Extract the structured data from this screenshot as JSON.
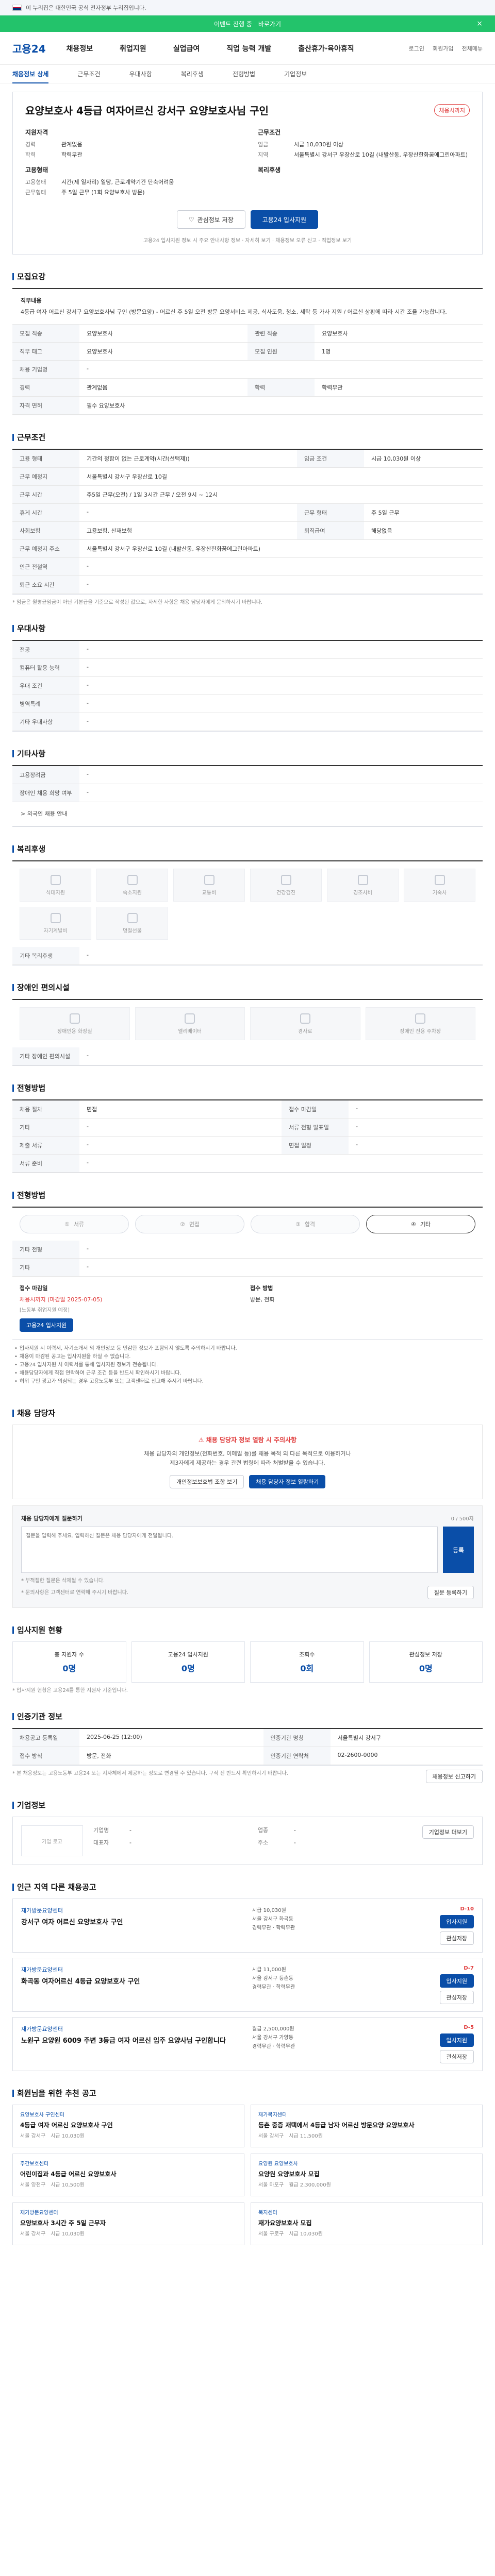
{
  "gov_bar": "이 누리집은 대한민국 공식 전자정부 누리집입니다.",
  "event_banner": {
    "text": "이벤트 진행 중",
    "cta": "바로가기",
    "close": "×"
  },
  "header": {
    "logo": "고용24",
    "gnb": [
      "채용정보",
      "취업지원",
      "실업급여",
      "직업 능력 개발",
      "출산휴가·육아휴직"
    ],
    "util": [
      "로그인",
      "회원가입",
      "전체메뉴"
    ]
  },
  "subnav": [
    "채용정보 상세",
    "근무조건",
    "우대사항",
    "복리후생",
    "전형방법",
    "기업정보"
  ],
  "job": {
    "title": "요양보호사 4등급 여자어르신 강서구 요양보호사님 구인",
    "badge": "채용시까지",
    "summary_left_title": "지원자격",
    "summary_left": [
      {
        "k": "경력",
        "v": "관계없음"
      },
      {
        "k": "학력",
        "v": "학력무관"
      }
    ],
    "summary_right_title": "근무조건",
    "summary_right": [
      {
        "k": "임금",
        "v": "시급 10,030원 이상"
      },
      {
        "k": "지역",
        "v": "서울특별시 강서구 우장산로 10길 (내발산동, 우장산한화꿈에그린아파트)"
      }
    ],
    "summary_left2_title": "고용형태",
    "summary_left2": [
      {
        "k": "고용형태",
        "v": "시간(제 일자리) 일당, 근로계약기간 단축어려움"
      },
      {
        "k": "근무형태",
        "v": "주 5일 근무 (1회 요양보호사 방문)"
      }
    ],
    "summary_right2_title": "복리후생",
    "summary_right2": [
      {
        "k": "",
        "v": ""
      }
    ],
    "btn_scrap": "관심정보 저장",
    "btn_apply": "고용24 입사지원",
    "notice": "고용24 입사지원 정보 시 주요 안내사항 정보 · 자세히 보기 · 채용정보 오류 신고 · 직업정보 보기"
  },
  "recruit": {
    "heading": "모집요강",
    "desc_label": "직무내용",
    "desc": "4등급 여자 어르신 강서구 요양보호사님 구인 (방문요양) - 어르신 주 5일 오전 방문 요양서비스 제공, 식사도움, 청소, 세탁 등 가사 지원 / 어르신 상황에 따라 시간 조율 가능합니다.",
    "rows": [
      {
        "k": "모집 직종",
        "v": "요양보호사",
        "k2": "관련 직종",
        "v2": "요양보호사"
      },
      {
        "k": "직무 태그",
        "v": "요양보호사",
        "k2": "모집 인원",
        "v2": "1명"
      },
      {
        "k": "채용 기업명",
        "v": "-",
        "k2": "",
        "v2": ""
      },
      {
        "k": "경력",
        "v": "관계없음",
        "k2": "학력",
        "v2": "학력무관"
      },
      {
        "k": "자격 면허",
        "v": "필수 요양보호사",
        "k2": "",
        "v2": ""
      }
    ]
  },
  "conditions": {
    "heading": "근무조건",
    "rows": [
      {
        "k": "고용 형태",
        "v": "기간의 정함이 없는 근로계약(시간(선택제))",
        "k2": "임금 조건",
        "v2": "시급 10,030원 이상"
      },
      {
        "k": "근무 예정지",
        "v": "서울특별시 강서구 우장산로 10길",
        "k2": "",
        "v2": ""
      },
      {
        "k": "근무 시간",
        "v": "주5일 근무(오전) / 1일 3시간 근무 / 오전 9시 ~ 12시",
        "k2": "",
        "v2": ""
      },
      {
        "k": "휴게 시간",
        "v": "-",
        "k2": "근무 형태",
        "v2": "주 5일 근무"
      },
      {
        "k": "사회보험",
        "v": "고용보험, 산재보험",
        "k2": "퇴직급여",
        "v2": "해당없음"
      },
      {
        "k": "근무 예정지 주소",
        "v": "서울특별시 강서구 우장산로 10길 (내발산동, 우장산한화꿈에그린아파트)",
        "k2": "",
        "v2": ""
      },
      {
        "k": "인근 전철역",
        "v": "-",
        "k2": "",
        "v2": ""
      },
      {
        "k": "퇴근 소요 시간",
        "v": "-",
        "k2": "",
        "v2": ""
      }
    ],
    "note": "* 임금은 월평균임금이 아닌 기본급을 기준으로 작성된 값으로, 자세한 사항은 채용 담당자에게 문의하시기 바랍니다."
  },
  "preference": {
    "heading": "우대사항",
    "rows": [
      {
        "k": "전공",
        "v": "-"
      },
      {
        "k": "컴퓨터 활용 능력",
        "v": "-"
      },
      {
        "k": "우대 조건",
        "v": "-"
      },
      {
        "k": "병역특례",
        "v": "-"
      },
      {
        "k": "기타 우대사항",
        "v": "-"
      }
    ]
  },
  "etc": {
    "heading": "기타사항",
    "rows": [
      {
        "k": "고용장려금",
        "v": "-"
      },
      {
        "k": "장애인 채용 희망 여부",
        "v": "-"
      }
    ],
    "link": "> 외국인 채용 안내"
  },
  "welfare": {
    "heading": "복리후생",
    "items": [
      "식대지원",
      "숙소지원",
      "교통비",
      "건강검진",
      "경조사비",
      "기숙사",
      "자기계발비",
      "명절선물"
    ],
    "extra_label": "기타 복리후생",
    "extra_value": "-"
  },
  "disabled": {
    "heading": "장애인 편의시설",
    "items": [
      "장애인용 화장실",
      "엘리베이터",
      "경사로",
      "장애인 전용 주차장"
    ],
    "extra_label": "기타 장애인 편의시설",
    "extra_value": "-"
  },
  "selection": {
    "heading": "전형방법",
    "rows": [
      {
        "k": "채용 절차",
        "v": "면접"
      },
      {
        "k": "기타",
        "v": "-"
      },
      {
        "k": "제출 서류",
        "v": "-"
      },
      {
        "k": "서류 준비",
        "v": "-"
      }
    ],
    "rows2": [
      {
        "k": "접수 마감일",
        "v": "-"
      },
      {
        "k": "서류 전형 발표일",
        "v": "-"
      },
      {
        "k": "면접 일정",
        "v": "-"
      }
    ]
  },
  "process": {
    "heading": "전형방법",
    "steps": [
      "서류",
      "면접",
      "합격",
      "기타"
    ],
    "on_index": 3,
    "rows": [
      {
        "k": "기타 전형",
        "v": "-"
      },
      {
        "k": "기타",
        "v": "-"
      }
    ],
    "apply_left_title": "접수 마감일",
    "apply_left_value": "채용시까지 (마감일 2025-07-05)",
    "apply_left_sub": "[노동부 취업지원 예정]",
    "apply_btn": "고용24 입사지원",
    "apply_right_title": "접수 방법",
    "apply_right_value": "방문, 전화",
    "bullets": [
      "입사지원 시 이력서, 자기소개서 외 개인정보 등 민감한 정보가 포함되지 않도록 주의하시기 바랍니다.",
      "채용이 마감된 공고는 입사지원을 하실 수 없습니다.",
      "고용24 입사지원 시 이력서를 통해 입사지원 정보가 전송됩니다.",
      "채용담당자에게 직접 연락하여 근무 조건 등을 반드시 확인하시기 바랍니다.",
      "허위 구인 광고가 의심되는 경우 고용노동부 또는 고객센터로 신고해 주시기 바랍니다."
    ]
  },
  "contact": {
    "heading": "채용 담당자",
    "warn": "채용 담당자 정보 열람 시 주의사항",
    "text1": "채용 담당자의 개인정보(전화번호, 이메일 등)를 채용 목적 외 다른 목적으로 이용하거나",
    "text2": "제3자에게 제공하는 경우 관련 법령에 따라 처벌받을 수 있습니다.",
    "btn1": "개인정보보호법 조항 보기",
    "btn2": "채용 담당자 정보 열람하기",
    "comment_title": "채용 담당자에게 질문하기",
    "comment_count": "0 / 500자",
    "comment_placeholder": "질문을 입력해 주세요. 입력하신 질문은 채용 담당자에게 전달됩니다.",
    "comment_send": "등록",
    "comment_notes": [
      "* 부적절한 질문은 삭제될 수 있습니다.",
      "* 문의사항은 고객센터로 연락해 주시기 바랍니다."
    ],
    "comment_btn": "질문 등록하기"
  },
  "stats": {
    "heading": "입사지원 현황",
    "items": [
      {
        "label": "총 지원자 수",
        "value": "0명"
      },
      {
        "label": "고용24 입사지원",
        "value": "0명"
      },
      {
        "label": "조회수",
        "value": "0회"
      },
      {
        "label": "관심정보 저장",
        "value": "0명"
      }
    ],
    "note": "* 입사지원 현황은 고용24를 통한 지원자 기준입니다."
  },
  "info": {
    "heading": "인증기관 정보",
    "rows": [
      {
        "k": "채용공고 등록일",
        "v": "2025-06-25 (12:00)",
        "k2": "인증기관 명칭",
        "v2": "서울특별시 강서구"
      },
      {
        "k": "접수 방식",
        "v": "방문, 전화",
        "k2": "인증기관 연락처",
        "v2": "02-2600-0000"
      }
    ],
    "note": "* 본 채용정보는 고용노동부 고용24 또는 지자체에서 제공하는 정보로 변경될 수 있습니다. 구직 전 반드시 확인하시기 바랍니다.",
    "btn": "채용정보 신고하기"
  },
  "company": {
    "heading": "기업정보",
    "logo": "기업 로고",
    "rows": [
      {
        "k": "기업명",
        "v": "-"
      },
      {
        "k": "업종",
        "v": "-"
      },
      {
        "k": "대표자",
        "v": "-"
      },
      {
        "k": "주소",
        "v": "-"
      }
    ],
    "btn": "기업정보 더보기"
  },
  "related": {
    "heading": "인근 지역 다른 채용공고",
    "jobs": [
      {
        "co": "재가방문요양센터",
        "title": "강서구 여자 어르신 요양보호사 구인",
        "m1": "시급 10,030원",
        "m2": "서울 강서구 화곡동",
        "m3": "경력무관 · 학력무관",
        "dday": "D-10"
      },
      {
        "co": "재가방문요양센터",
        "title": "화곡동 여자어르신 4등급 요양보호사 구인",
        "m1": "시급 11,000원",
        "m2": "서울 강서구 등촌동",
        "m3": "경력무관 · 학력무관",
        "dday": "D-7"
      },
      {
        "co": "재가방문요양센터",
        "title": "노원구 요양원 6009 주변 3등급 여자 어르신 입주 요양사님 구인합니다",
        "m1": "월급 2,500,000원",
        "m2": "서울 강서구 가양동",
        "m3": "경력무관 · 학력무관",
        "dday": "D-5"
      }
    ],
    "btn_apply": "입사지원",
    "btn_scrap": "관심저장"
  },
  "recommend": {
    "heading": "회원님을 위한 추천 공고",
    "cards": [
      {
        "co": "요양보호사 구인센터",
        "title": "4등급 여자 어르신 요양보호사 구인",
        "meta1": "서울 강서구",
        "meta2": "시급 10,030원"
      },
      {
        "co": "재가복지센터",
        "title": "등촌 중증 재택에서 4등급 남자 어르신 방문요양 요양보호사",
        "meta1": "서울 강서구",
        "meta2": "시급 11,500원"
      },
      {
        "co": "주간보호센터",
        "title": "어린이집과 4등급 어르신 요양보호사",
        "meta1": "서울 양천구",
        "meta2": "시급 10,500원"
      },
      {
        "co": "요양원 요양보호사",
        "title": "요양원 요양보호사 모집",
        "meta1": "서울 마포구",
        "meta2": "월급 2,300,000원"
      },
      {
        "co": "재가방문요양센터",
        "title": "요양보호사 3시간 주 5일 근무자",
        "meta1": "서울 강서구",
        "meta2": "시급 10,030원"
      },
      {
        "co": "복지센터",
        "title": "재가요양보호사 모집",
        "meta1": "서울 구로구",
        "meta2": "시급 10,030원"
      }
    ]
  }
}
